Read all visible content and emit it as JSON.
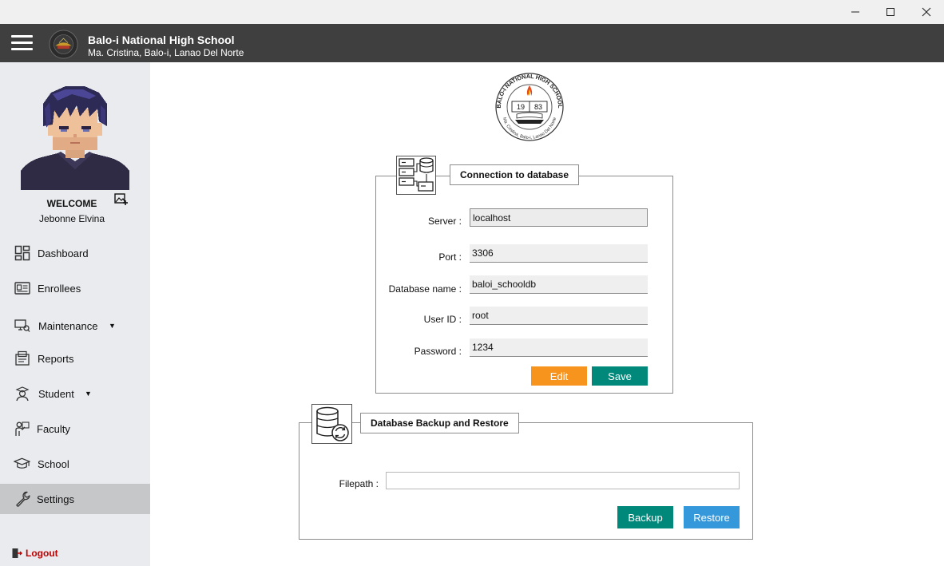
{
  "window": {
    "minimize_icon": "minimize-icon",
    "maximize_icon": "maximize-icon",
    "close_icon": "close-icon"
  },
  "header": {
    "title": "Balo-i National High School",
    "address": "Ma. Cristina, Balo-i, Lanao Del Norte",
    "bg_color": "#3f3f3f"
  },
  "sidebar": {
    "welcome": "WELCOME",
    "username": "Jebonne Elvina",
    "items": [
      {
        "label": "Dashboard",
        "icon": "dashboard-icon"
      },
      {
        "label": "Enrollees",
        "icon": "id-card-icon"
      },
      {
        "label": "Maintenance",
        "icon": "maintenance-icon",
        "caret": "▼"
      },
      {
        "label": "Reports",
        "icon": "reports-icon"
      },
      {
        "label": "Student",
        "icon": "student-icon",
        "caret": "▼"
      },
      {
        "label": "Faculty",
        "icon": "faculty-icon"
      },
      {
        "label": "School",
        "icon": "school-icon"
      },
      {
        "label": "Settings",
        "icon": "wrench-icon",
        "active": true
      }
    ],
    "logout": "Logout"
  },
  "seal": {
    "top_text": "BALO-I NATIONAL HIGH SCHOOL",
    "bottom_text": "Ma. Cristina, Balo-i, Lanao Del Norte",
    "year_left": "19",
    "year_right": "83"
  },
  "connection": {
    "title": "Connection to database",
    "fields": [
      {
        "label": "Server :",
        "value": "localhost"
      },
      {
        "label": "Port :",
        "value": "3306"
      },
      {
        "label": "Database name :",
        "value": "baloi_schooldb"
      },
      {
        "label": "User ID :",
        "value": "root"
      },
      {
        "label": "Password :",
        "value": "1234"
      }
    ],
    "edit_label": "Edit",
    "save_label": "Save",
    "edit_color": "#f7941d",
    "save_color": "#00897b"
  },
  "backup": {
    "title": "Database Backup and Restore",
    "filepath_label": "Filepath :",
    "filepath_value": "",
    "backup_label": "Backup",
    "restore_label": "Restore",
    "backup_color": "#00897b",
    "restore_color": "#3498db"
  }
}
